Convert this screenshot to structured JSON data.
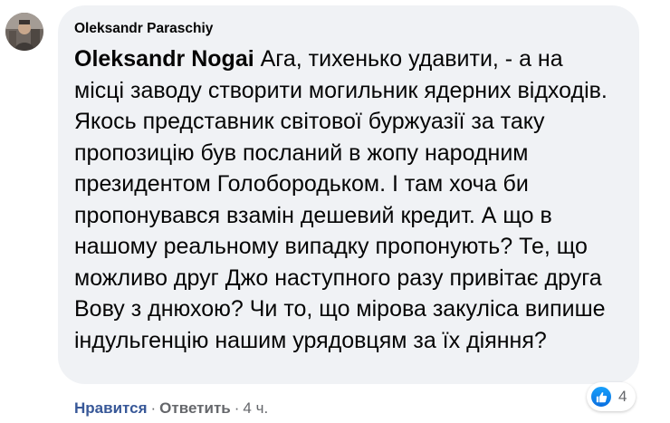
{
  "comment": {
    "author": "Oleksandr Paraschiy",
    "mention": "Oleksandr Nogai",
    "text": " Ага, тихенько удавити, - а на місці заводу створити могильник ядерних відходів. Якось представник світової буржуазії за таку пропозицію був посланий в жопу народним президентом Голобородьком. І там хоча би пропонувався взамін дешевий кредит. А що в нашому реальному випадку пропонують? Те, що можливо друг Джо наступного разу привітає друга Вову з днюхою? Чи то, що мірова закуліса випише індульгенцію нашим урядовцям за їх діяння?"
  },
  "actions": {
    "like_label": "Нравится",
    "separator": "·",
    "reply_label": "Ответить",
    "time": "4 ч."
  },
  "reactions": {
    "icon": "like-icon",
    "count": "4"
  },
  "colors": {
    "bubble_bg": "#f0f2f5",
    "like_link": "#385898",
    "muted": "#65676b",
    "like_icon": "#1877f2"
  }
}
